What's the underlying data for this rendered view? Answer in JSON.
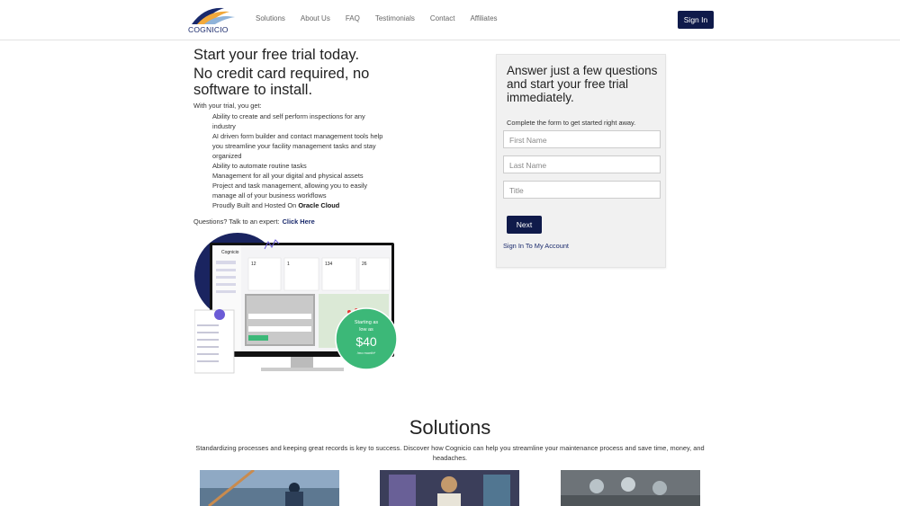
{
  "header": {
    "logo_text": "COGNICIO",
    "nav": [
      "Solutions",
      "About Us",
      "FAQ",
      "Testimonials",
      "Contact",
      "Affiliates"
    ],
    "signin_label": "Sign In"
  },
  "hero": {
    "title": "Start your free trial today.",
    "subtitle": "No credit card required, no software to install.",
    "intro": "With your trial, you get:",
    "bullets": [
      "Ability to create and self perform inspections for any industry",
      "AI driven form builder and contact management tools help you streamline your facility management tasks and stay organized",
      "Ability to automate routine tasks",
      "Management for all your digital and physical assets",
      "Project and task management, allowing you to easily manage all of your business workflows"
    ],
    "oracle_prefix": "Proudly Built and Hosted On ",
    "oracle_bold": "Oracle Cloud",
    "questions_text": "Questions? Talk to an expert:",
    "questions_link": "Click Here"
  },
  "illustration": {
    "app_name": "Cognicio",
    "stats": [
      "12",
      "1",
      "134",
      "26"
    ],
    "price_line1": "Starting as",
    "price_line2": "low as",
    "price": "$40",
    "price_suffix": "/mo month*"
  },
  "form": {
    "title": "Answer just a few questions and start your free trial immediately.",
    "description": "Complete the form to get started right away.",
    "first_name_placeholder": "First Name",
    "last_name_placeholder": "Last Name",
    "title_placeholder": "Title",
    "next_label": "Next",
    "account_link": "Sign In To My Account"
  },
  "solutions": {
    "title": "Solutions",
    "description": "Standardizing processes and keeping great records is key to success. Discover how Cognicio can help you streamline your maintenance process and save time, money, and headaches."
  },
  "colors": {
    "brand_navy": "#0f1a4a",
    "price_badge": "#3cb878",
    "form_bg": "#f1f1f1"
  }
}
